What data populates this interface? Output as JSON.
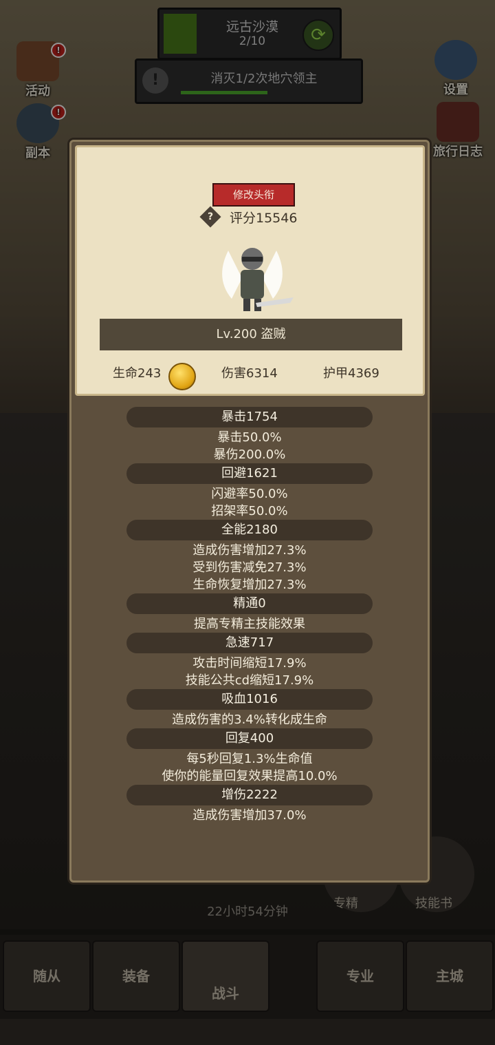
{
  "stage": {
    "name": "远古沙漠",
    "progress": "2/10"
  },
  "quest": {
    "text": "消灭1/2次地穴领主",
    "progress_fraction": 0.5
  },
  "side_buttons": {
    "activity": "活动",
    "dungeon": "副本",
    "settings": "设置",
    "travel_log": "旅行日志"
  },
  "character": {
    "change_title_label": "修改头衔",
    "score": "评分15546",
    "level_class": "Lv.200 盗贼",
    "hp": "生命243",
    "damage": "伤害6314",
    "armor": "护甲4369"
  },
  "stats": [
    {
      "header": "暴击1754",
      "lines": [
        "暴击50.0%",
        "暴伤200.0%"
      ]
    },
    {
      "header": "回避1621",
      "lines": [
        "闪避率50.0%",
        "招架率50.0%"
      ]
    },
    {
      "header": "全能2180",
      "lines": [
        "造成伤害增加27.3%",
        "受到伤害减免27.3%",
        "生命恢复增加27.3%"
      ]
    },
    {
      "header": "精通0",
      "lines": [
        "提高专精主技能效果"
      ]
    },
    {
      "header": "急速717",
      "lines": [
        "攻击时间缩短17.9%",
        "技能公共cd缩短17.9%"
      ]
    },
    {
      "header": "吸血1016",
      "lines": [
        "造成伤害的3.4%转化成生命"
      ]
    },
    {
      "header": "回复400",
      "lines": [
        "每5秒回复1.3%生命值",
        "使你的能量回复效果提高10.0%"
      ]
    },
    {
      "header": "增伤2222",
      "lines": [
        "造成伤害增加37.0%"
      ]
    }
  ],
  "background": {
    "timer": "22小时54分钟",
    "round_buttons": {
      "specialty": "专精",
      "skill_book": "技能书"
    }
  },
  "nav": {
    "followers": "随从",
    "equipment": "装备",
    "battle": "战斗",
    "profession": "专业",
    "main_city": "主城"
  },
  "colors": {
    "title_button": "#b72b2a",
    "modal_bg": "#5d4f3d",
    "card_bg": "#ece1c3",
    "pill": "#3e3429"
  }
}
